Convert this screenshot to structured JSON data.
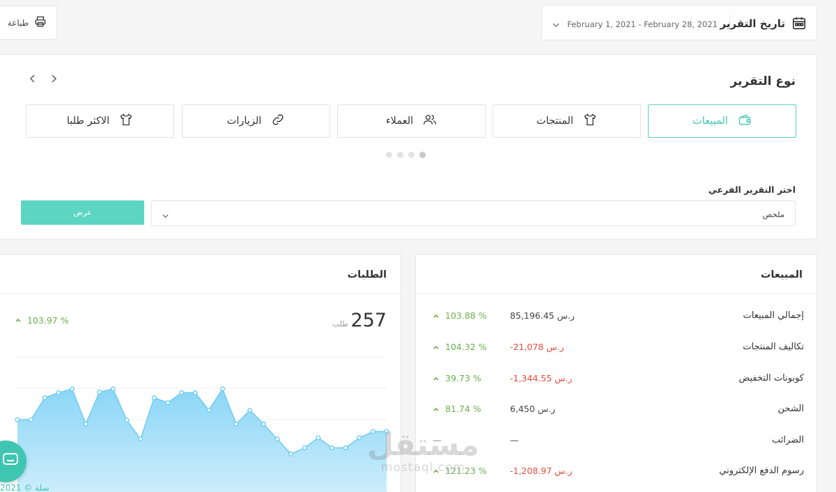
{
  "toolbar": {
    "print_label": "طباعة",
    "report_date_label": "تاريخ التقرير",
    "date_range": "February 1, 2021 - February 28, 2021"
  },
  "report_type": {
    "title": "نوع التقرير",
    "tabs": [
      {
        "label": "المبيعات",
        "icon": "wallet-icon",
        "active": true
      },
      {
        "label": "المنتجات",
        "icon": "tshirt-icon",
        "active": false
      },
      {
        "label": "العملاء",
        "icon": "users-icon",
        "active": false
      },
      {
        "label": "الزيارات",
        "icon": "link-icon",
        "active": false
      },
      {
        "label": "الاكثر طلبا",
        "icon": "tshirt-icon",
        "active": false
      }
    ],
    "subreport_label": "اختر التقرير الفرعي",
    "subreport_value": "ملخص",
    "show_button": "عرض"
  },
  "orders": {
    "title": "الطلبات",
    "count": "257",
    "unit": "طلب",
    "change": "103.97 %"
  },
  "sales": {
    "title": "المبيعات",
    "rows": [
      {
        "name": "إجمالي المبيعات",
        "amount": "85,196.45 ر.س",
        "negative": false,
        "change": "103.88 %"
      },
      {
        "name": "تكاليف المنتجات",
        "amount": "-21,078 ر.س",
        "negative": true,
        "change": "104.32 %"
      },
      {
        "name": "كوبونات التخفيض",
        "amount": "-1,344.55 ر.س",
        "negative": true,
        "change": "39.73 %"
      },
      {
        "name": "الشحن",
        "amount": "6,450 ر.س",
        "negative": false,
        "change": "81.74 %"
      },
      {
        "name": "الضرائب",
        "amount": "—",
        "negative": false,
        "change": "—"
      },
      {
        "name": "رسوم الدفع الإلكتروني",
        "amount": "-1,208.97 ر.س",
        "negative": true,
        "change": "121.23 %"
      }
    ]
  },
  "watermark": {
    "arabic": "مستقل",
    "latin": "mostaql.com"
  },
  "footer": {
    "text": "سلة © 2021"
  },
  "colors": {
    "accent": "#3fc6b3",
    "positive": "#6ab04c",
    "negative": "#e74c3c",
    "chart_fill": "#9fdcf8",
    "chart_line": "#6dccf3"
  },
  "chart_data": {
    "type": "area",
    "series": [
      {
        "values": [
          5,
          5,
          8.5,
          9.3,
          9.9,
          4.3,
          9.4,
          9.9,
          4.9,
          1.9,
          8.5,
          7.7,
          9.3,
          9.3,
          6.5,
          9.9,
          4.3,
          6.5,
          4.3,
          1.9,
          -0.5,
          0.5,
          2.1,
          0.5,
          0.5,
          2.1,
          3.1,
          3.1
        ]
      }
    ],
    "ylim": [
      -5,
      15
    ],
    "grid": true
  }
}
